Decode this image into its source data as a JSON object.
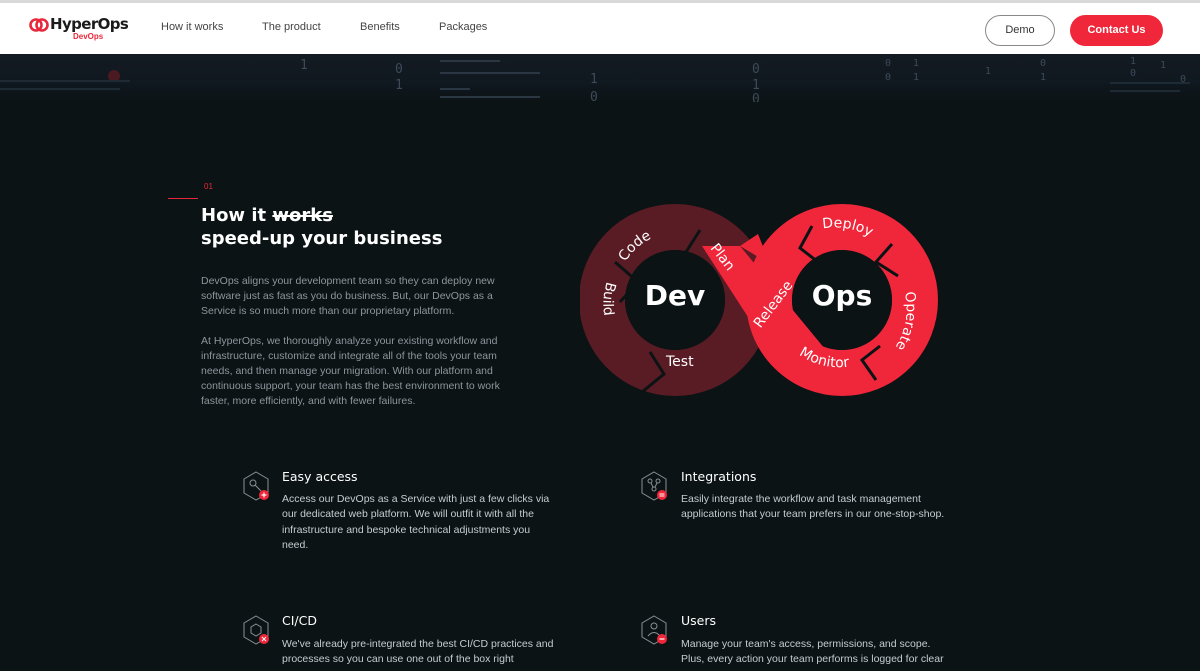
{
  "brand": {
    "name": "HyperOps",
    "sub": "DevOps",
    "accent": "#f0263a"
  },
  "nav": {
    "links": [
      "How it works",
      "The product",
      "Benefits",
      "Packages"
    ],
    "demo_label": "Demo",
    "contact_label": "Contact Us"
  },
  "section": {
    "number": "01",
    "title_prefix": "How it ",
    "title_strike": "works",
    "title_line2": "speed-up your business",
    "paragraphs": [
      "DevOps aligns your development team so they can deploy new software just as fast as you do business. But, our DevOps as a Service is so much more than our proprietary platform.",
      "At HyperOps, we thoroughly analyze your existing workflow and infrastructure, customize and integrate all of the tools your team needs, and then manage your migration. With our platform and continuous support, your team has the best environment to work faster, more efficiently, and with fewer failures."
    ]
  },
  "diagram": {
    "dev_label": "Dev",
    "ops_label": "Ops",
    "stages": [
      "Code",
      "Plan",
      "Build",
      "Test",
      "Release",
      "Deploy",
      "Operate",
      "Monitor"
    ]
  },
  "features": [
    {
      "title": "Easy access",
      "text": "Access our DevOps as a Service with just a few clicks via our dedicated web platform. We will outfit it with all the infrastructure and bespoke technical adjustments you need.",
      "icon": "key-icon"
    },
    {
      "title": "Integrations",
      "text": "Easily integrate the workflow and task management applications that your team prefers in our one-stop-shop.",
      "icon": "nodes-icon"
    },
    {
      "title": "CI/CD",
      "text": "We've already pre-integrated the best CI/CD practices and processes so you can use one out of the box right",
      "icon": "pipeline-icon"
    },
    {
      "title": "Users",
      "text": "Manage your team's access, permissions, and scope. Plus, every action your team performs is logged for clear",
      "icon": "user-icon"
    }
  ]
}
